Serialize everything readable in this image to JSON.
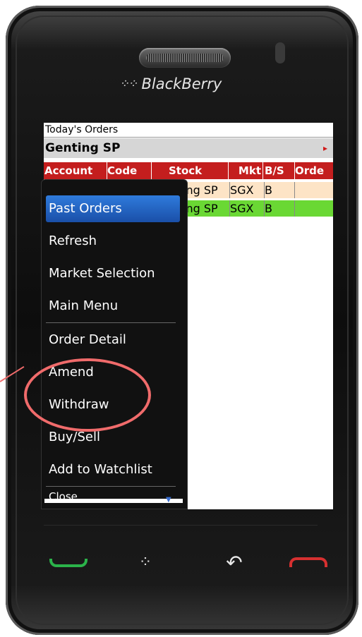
{
  "device": {
    "brand": "BlackBerry",
    "brand_logo": "blackberry-logo-icon"
  },
  "screen": {
    "title": "Today's Orders",
    "stock_name": "Genting SP",
    "stock_arrow": "▸",
    "table": {
      "headers": [
        "Account",
        "Code",
        "Stock",
        "Mkt",
        "B/S",
        "Orde"
      ],
      "rows": [
        {
          "stock": "ing SP",
          "mkt": "SGX",
          "bs": "B",
          "status_color": "#fde4c6"
        },
        {
          "stock": "ing SP",
          "mkt": "SGX",
          "bs": "B",
          "status_color": "#6ad834"
        }
      ]
    }
  },
  "menu": {
    "items": [
      {
        "label": "Past Orders",
        "selected": true
      },
      {
        "label": "Refresh"
      },
      {
        "label": "Market Selection"
      },
      {
        "label": "Main Menu"
      },
      {
        "label": "Order Detail"
      },
      {
        "label": "Amend"
      },
      {
        "label": "Withdraw"
      },
      {
        "label": "Buy/Sell"
      },
      {
        "label": "Add to Watchlist"
      },
      {
        "label": "Close"
      }
    ]
  },
  "hardware_keys": {
    "call": "call-icon",
    "menu": "blackberry-menu-icon",
    "back": "back-arrow-icon",
    "end": "end-call-icon"
  },
  "colors": {
    "header_red": "#c41e1e",
    "selected_blue": "#2f7bdc",
    "callout": "#f06b6b",
    "call_green": "#2bb34a",
    "end_red": "#d63030"
  }
}
